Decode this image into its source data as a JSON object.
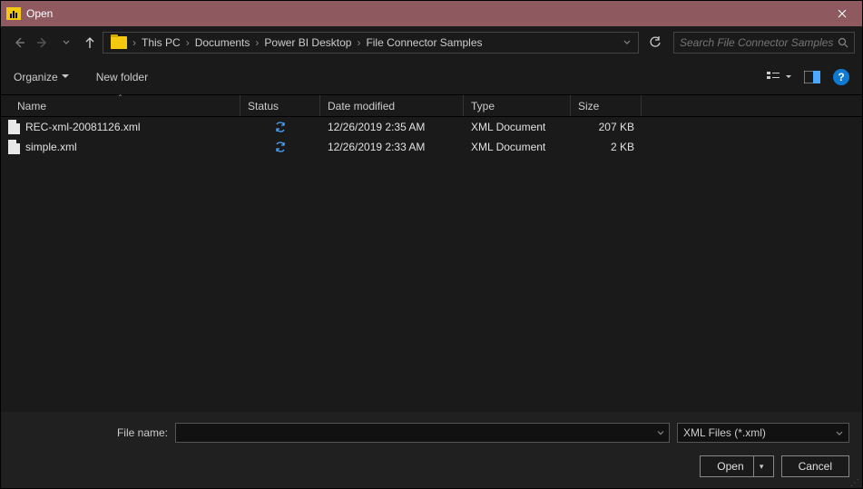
{
  "title": "Open",
  "breadcrumbs": [
    "This PC",
    "Documents",
    "Power BI Desktop",
    "File Connector Samples"
  ],
  "search_placeholder": "Search File Connector Samples",
  "toolbar": {
    "organize": "Organize",
    "new_folder": "New folder"
  },
  "columns": {
    "name": "Name",
    "status": "Status",
    "date": "Date modified",
    "type": "Type",
    "size": "Size"
  },
  "files": [
    {
      "name": "REC-xml-20081126.xml",
      "date": "12/26/2019 2:35 AM",
      "type": "XML Document",
      "size": "207 KB"
    },
    {
      "name": "simple.xml",
      "date": "12/26/2019 2:33 AM",
      "type": "XML Document",
      "size": "2 KB"
    }
  ],
  "filename_label": "File name:",
  "filter": "XML Files (*.xml)",
  "buttons": {
    "open": "Open",
    "cancel": "Cancel"
  }
}
